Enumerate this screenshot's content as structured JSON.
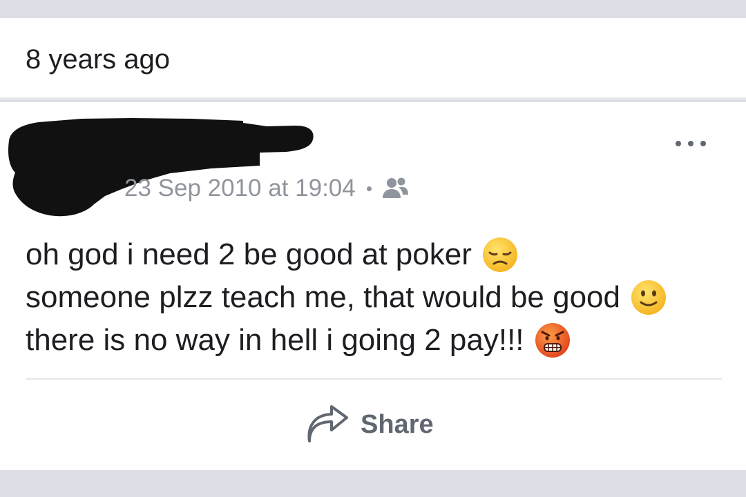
{
  "memory": {
    "label": "8 years ago"
  },
  "post": {
    "timestamp": "23 Sep 2010 at 19:04",
    "audience_icon": "friends-icon",
    "lines": [
      {
        "text": "oh god i need 2 be good at poker",
        "emoji": "disappointed-face-emoji"
      },
      {
        "text": "someone plzz teach me, that would be good",
        "emoji": "slightly-smiling-face-emoji"
      },
      {
        "text": "there is no way in hell i going 2 pay!!!",
        "emoji": "angry-face-emoji"
      }
    ]
  },
  "actions": {
    "share_label": "Share",
    "share_icon": "share-arrow-icon",
    "more_icon": "more-options-icon"
  },
  "colors": {
    "background": "#dddfe6",
    "card": "#ffffff",
    "text_primary": "#1c1e21",
    "text_secondary": "#90949c",
    "action_gray": "#606770",
    "redaction": "#111111"
  }
}
